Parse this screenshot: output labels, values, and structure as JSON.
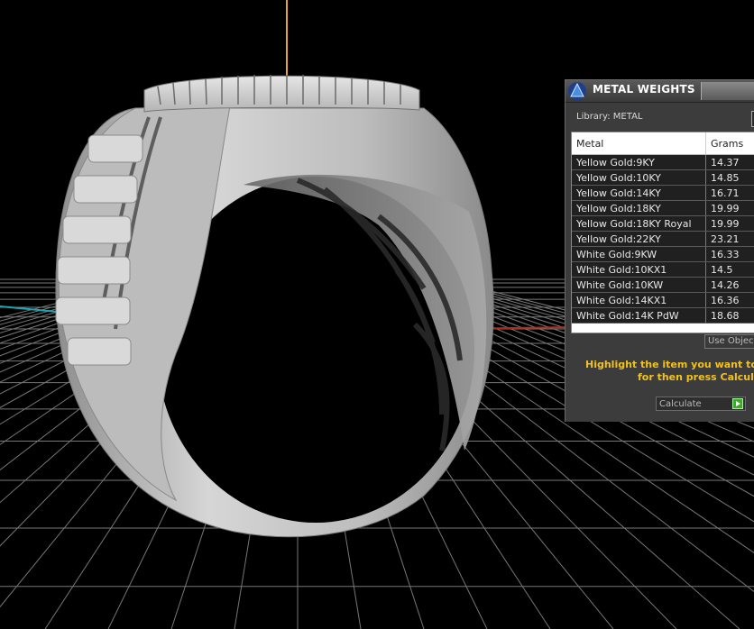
{
  "panel": {
    "title": "METAL WEIGHTS",
    "library_label": "Library: METAL",
    "table": {
      "columns": [
        "Metal",
        "Grams"
      ],
      "rows": [
        [
          "Yellow Gold:9KY",
          "14.37"
        ],
        [
          "Yellow Gold:10KY",
          "14.85"
        ],
        [
          "Yellow Gold:14KY",
          "16.71"
        ],
        [
          "Yellow Gold:18KY",
          "19.99"
        ],
        [
          "Yellow Gold:18KY Royal",
          "19.99"
        ],
        [
          "Yellow Gold:22KY",
          "23.21"
        ],
        [
          "White Gold:9KW",
          "16.33"
        ],
        [
          "White Gold:10KX1",
          "14.5"
        ],
        [
          "White Gold:10KW",
          "14.26"
        ],
        [
          "White Gold:14KX1",
          "16.36"
        ],
        [
          "White Gold:14K PdW",
          "18.68"
        ]
      ]
    },
    "use_object_label": "Use Objec",
    "instruction_line1": "Highlight the item you want to fin",
    "instruction_line2": "for then press Calculat",
    "calculate_label": "Calculate"
  },
  "colors": {
    "viewport_bg": "#000000",
    "grid": "#8c8c8c",
    "axis_x": "#b02a1e",
    "axis_cyan": "#1fa6b5",
    "axis_y": "#e8a23a",
    "ring": "#c8c8c8",
    "instruction": "#f2c21c",
    "calculate_go": "#3fa82a"
  },
  "icons": {
    "panel_logo": "pyramid-logo-icon",
    "calculate": "play-arrow-icon"
  }
}
